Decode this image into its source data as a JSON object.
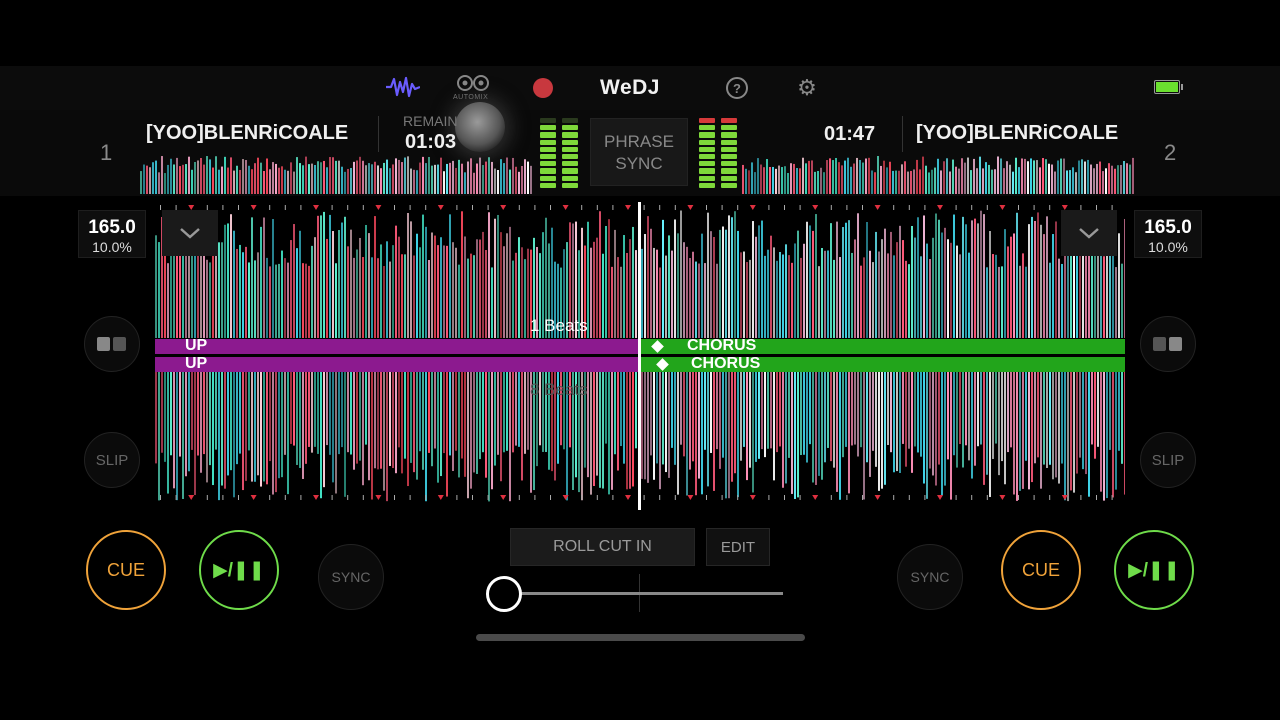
{
  "header": {
    "app_name": "WeDJ",
    "automix_label": "AUTOMIX",
    "help_glyph": "?"
  },
  "decks": [
    {
      "number": "1",
      "title": "[YOO]BLENRiCOALE",
      "time_label": "REMAIN",
      "time": "01:03",
      "bpm": "165.0",
      "pitch": "10.0%",
      "cue_label": "CUE",
      "play_label": "▶/❚❚",
      "sync_label": "SYNC",
      "slip_label": "SLIP",
      "beats_label": "1 Beats",
      "phrases": [
        "UP",
        "CHORUS"
      ]
    },
    {
      "number": "2",
      "title": "[YOO]BLENRiCOALE",
      "time": "01:47",
      "bpm": "165.0",
      "pitch": "10.0%",
      "cue_label": "CUE",
      "play_label": "▶/❚❚",
      "sync_label": "SYNC",
      "slip_label": "SLIP",
      "beats_label": "8 Beats",
      "phrases": [
        "UP",
        "CHORUS"
      ]
    }
  ],
  "center": {
    "phrase_sync_line1": "PHRASE",
    "phrase_sync_line2": "SYNC",
    "fx_label": "ROLL CUT IN",
    "edit_label": "EDIT",
    "crossfader_position": 0.0
  },
  "colors": {
    "cue": "#f0a33a",
    "play": "#6fdc4a",
    "phrase_up": "#8c1a8f",
    "phrase_chorus": "#22a51b",
    "battery": "#6be02f",
    "record": "#c8383e"
  },
  "icons": {
    "waveform": "waveform-icon",
    "automix": "automix-icon",
    "record": "record-icon",
    "help": "help-icon",
    "settings": "gear-icon",
    "battery": "battery-icon",
    "chevron": "chevron-down-icon",
    "pad_mode": "pad-mode-icon"
  }
}
